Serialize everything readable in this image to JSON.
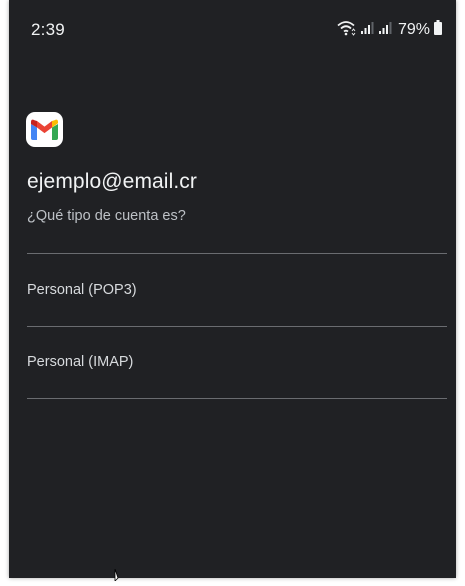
{
  "status_bar": {
    "time": "2:39",
    "battery_percent": "79%",
    "icons": [
      "wifi-icon",
      "signal-icon",
      "signal-icon",
      "battery-icon"
    ]
  },
  "account": {
    "logo": "gmail-logo",
    "email": "ejemplo@email.cr",
    "question": "¿Qué tipo de cuenta es?"
  },
  "options": [
    {
      "label": "Personal (POP3)"
    },
    {
      "label": "Personal (IMAP)"
    }
  ],
  "colors": {
    "background": "#202124",
    "text_primary": "#f1f3f4",
    "text_secondary": "#bdc1c6",
    "divider": "#6a6c70"
  }
}
